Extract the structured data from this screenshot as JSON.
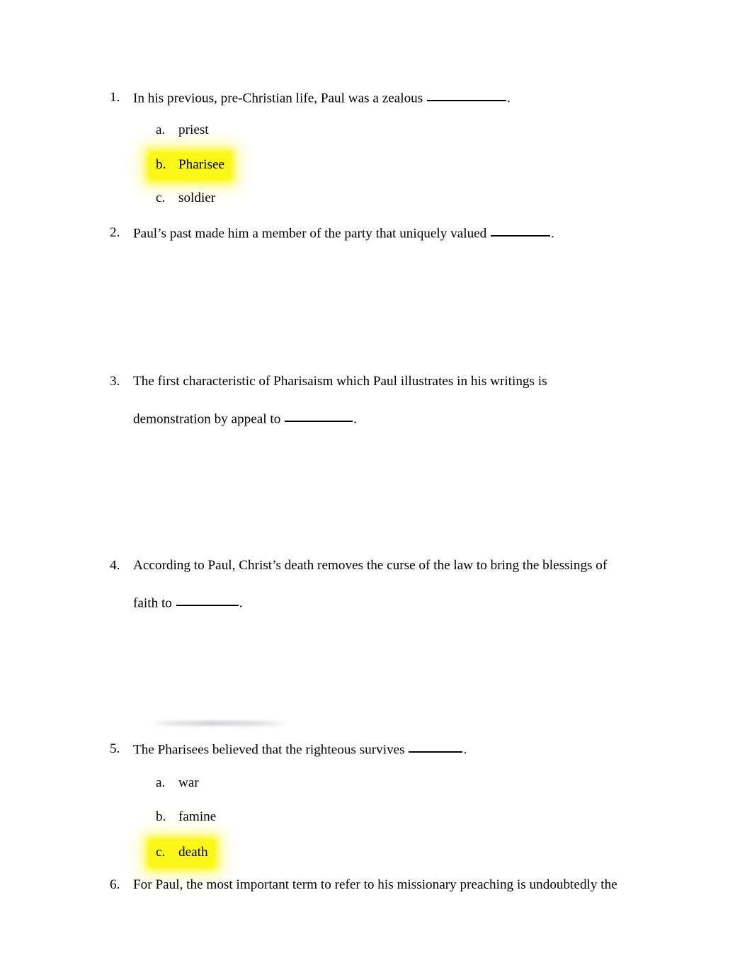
{
  "page": {
    "background_color": "#ffffff",
    "text_color": "#000000",
    "highlight_color": "#fbf717"
  },
  "questions": [
    {
      "number": "1.",
      "text_before": "In his previous, pre-Christian life, Paul was a zealous ",
      "blank_width": 112,
      "text_after": ".",
      "options": [
        {
          "letter": "a.",
          "label": "priest",
          "highlighted": false
        },
        {
          "letter": "b.",
          "label": "Pharisee",
          "highlighted": true
        },
        {
          "letter": "c.",
          "label": "soldier",
          "highlighted": false
        }
      ]
    },
    {
      "number": "2.",
      "text_before": "Paul’s past made him a member of the party that uniquely valued ",
      "blank_width": 84,
      "text_after": ".",
      "options": []
    },
    {
      "number": "3.",
      "line1": "The first characteristic of Pharisaism which Paul illustrates in his writings is",
      "line2_before": "demonstration by appeal to ",
      "blank_width": 96,
      "line2_after": ".",
      "options": []
    },
    {
      "number": "4.",
      "line1": "According to Paul, Christ’s death removes the curse of the law to bring the blessings of",
      "line2_before": "faith to ",
      "blank_width": 88,
      "line2_after": ".",
      "options": []
    },
    {
      "number": "5.",
      "text_before": "The Pharisees believed that the righteous survives ",
      "blank_width": 76,
      "text_after": ".",
      "options": [
        {
          "letter": "a.",
          "label": "war",
          "highlighted": false
        },
        {
          "letter": "b.",
          "label": "famine",
          "highlighted": false
        },
        {
          "letter": "c.",
          "label": "death",
          "highlighted": true
        }
      ]
    },
    {
      "number": "6.",
      "text_before": "For Paul, the most important term to refer to his missionary preaching is undoubtedly the",
      "blank_width": 0,
      "text_after": "",
      "options": []
    }
  ]
}
